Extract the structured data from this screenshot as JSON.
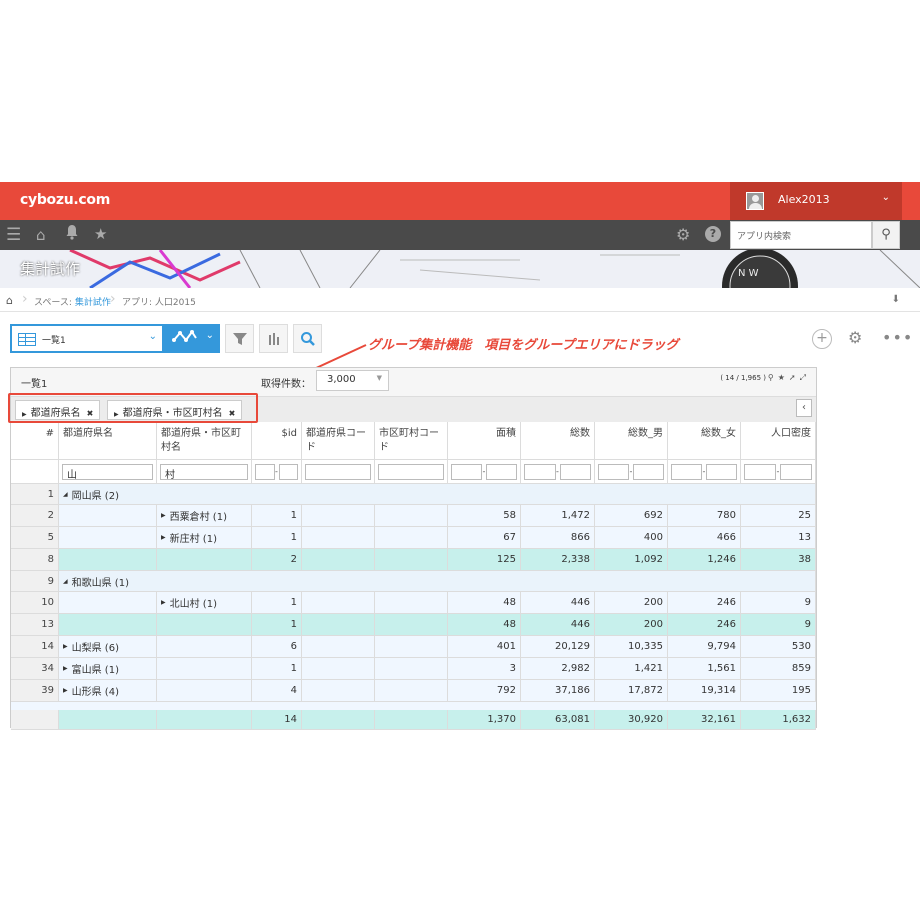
{
  "header": {
    "logo": "cybozu.com",
    "username": "Alex2013",
    "search_placeholder": "アプリ内検索"
  },
  "banner": {
    "title": "集計試作"
  },
  "breadcrumb": {
    "space_prefix": "スペース: ",
    "space_name": "集計試作",
    "app_label": "アプリ: 人口2015"
  },
  "toolbar": {
    "view_name": "一覧1"
  },
  "annotation": "グループ集計機能　項目をグループエリアにドラッグ",
  "panel": {
    "title": "一覧1",
    "records_label": "取得件数：",
    "records_value": "3,000",
    "pager": "( 14 / 1,965 )"
  },
  "group_chips": [
    "都道府県名",
    "都道府県・市区町村名"
  ],
  "columns": [
    {
      "label": "#",
      "num": true
    },
    {
      "label": "都道府県名",
      "num": false
    },
    {
      "label": "都道府県・市区町村名",
      "num": false
    },
    {
      "label": "$id",
      "num": true
    },
    {
      "label": "都道府県コード",
      "num": false
    },
    {
      "label": "市区町村コード",
      "num": false
    },
    {
      "label": "面積",
      "num": true
    },
    {
      "label": "総数",
      "num": true
    },
    {
      "label": "総数_男",
      "num": true
    },
    {
      "label": "総数_女",
      "num": true
    },
    {
      "label": "人口密度",
      "num": true
    }
  ],
  "filters": {
    "prefecture": "山",
    "municipality": "村"
  },
  "rows": [
    {
      "type": "grp",
      "num": "1",
      "label": "岡山県 (2)",
      "open": true
    },
    {
      "type": "data",
      "num": "2",
      "muni": "西粟倉村 (1)",
      "id": "1",
      "area": "58",
      "total": "1,472",
      "male": "692",
      "female": "780",
      "density": "25"
    },
    {
      "type": "data",
      "num": "5",
      "muni": "新庄村 (1)",
      "id": "1",
      "area": "67",
      "total": "866",
      "male": "400",
      "female": "466",
      "density": "13"
    },
    {
      "type": "sub",
      "num": "8",
      "id": "2",
      "area": "125",
      "total": "2,338",
      "male": "1,092",
      "female": "1,246",
      "density": "38"
    },
    {
      "type": "grp",
      "num": "9",
      "label": "和歌山県 (1)",
      "open": true
    },
    {
      "type": "data",
      "num": "10",
      "muni": "北山村 (1)",
      "id": "1",
      "area": "48",
      "total": "446",
      "male": "200",
      "female": "246",
      "density": "9"
    },
    {
      "type": "sub",
      "num": "13",
      "id": "1",
      "area": "48",
      "total": "446",
      "male": "200",
      "female": "246",
      "density": "9"
    },
    {
      "type": "data",
      "num": "14",
      "pref": "山梨県 (6)",
      "id": "6",
      "area": "401",
      "total": "20,129",
      "male": "10,335",
      "female": "9,794",
      "density": "530"
    },
    {
      "type": "data",
      "num": "34",
      "pref": "富山県 (1)",
      "id": "1",
      "area": "3",
      "total": "2,982",
      "male": "1,421",
      "female": "1,561",
      "density": "859"
    },
    {
      "type": "data",
      "num": "39",
      "pref": "山形県 (4)",
      "id": "4",
      "area": "792",
      "total": "37,186",
      "male": "17,872",
      "female": "19,314",
      "density": "195"
    }
  ],
  "grand_total": {
    "id": "14",
    "area": "1,370",
    "total": "63,081",
    "male": "30,920",
    "female": "32,161",
    "density": "1,632"
  }
}
